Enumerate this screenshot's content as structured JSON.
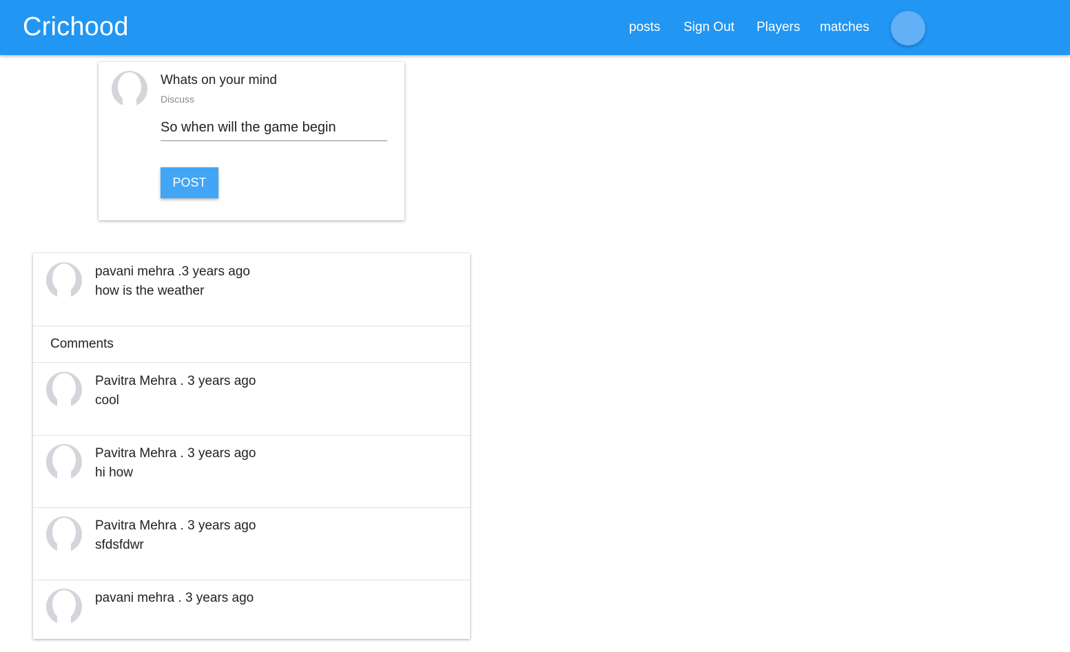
{
  "navbar": {
    "brand": "Crichood",
    "links": [
      "posts",
      "Sign Out",
      "Players",
      "matches"
    ],
    "color": "#2196f3"
  },
  "compose": {
    "title": "Whats on your mind",
    "subtitle": "Discuss",
    "input_value": "So when will the game begin",
    "button_label": "POST"
  },
  "post": {
    "meta": "pavani mehra .3 years ago",
    "text": "how is the weather",
    "comments_label": "Comments",
    "comments": [
      {
        "meta": "Pavitra Mehra . 3 years ago",
        "text": "cool"
      },
      {
        "meta": "Pavitra Mehra . 3 years ago",
        "text": "hi how"
      },
      {
        "meta": "Pavitra Mehra . 3 years ago",
        "text": "sfdsfdwr"
      },
      {
        "meta": "pavani mehra . 3 years ago",
        "text": ""
      }
    ]
  }
}
